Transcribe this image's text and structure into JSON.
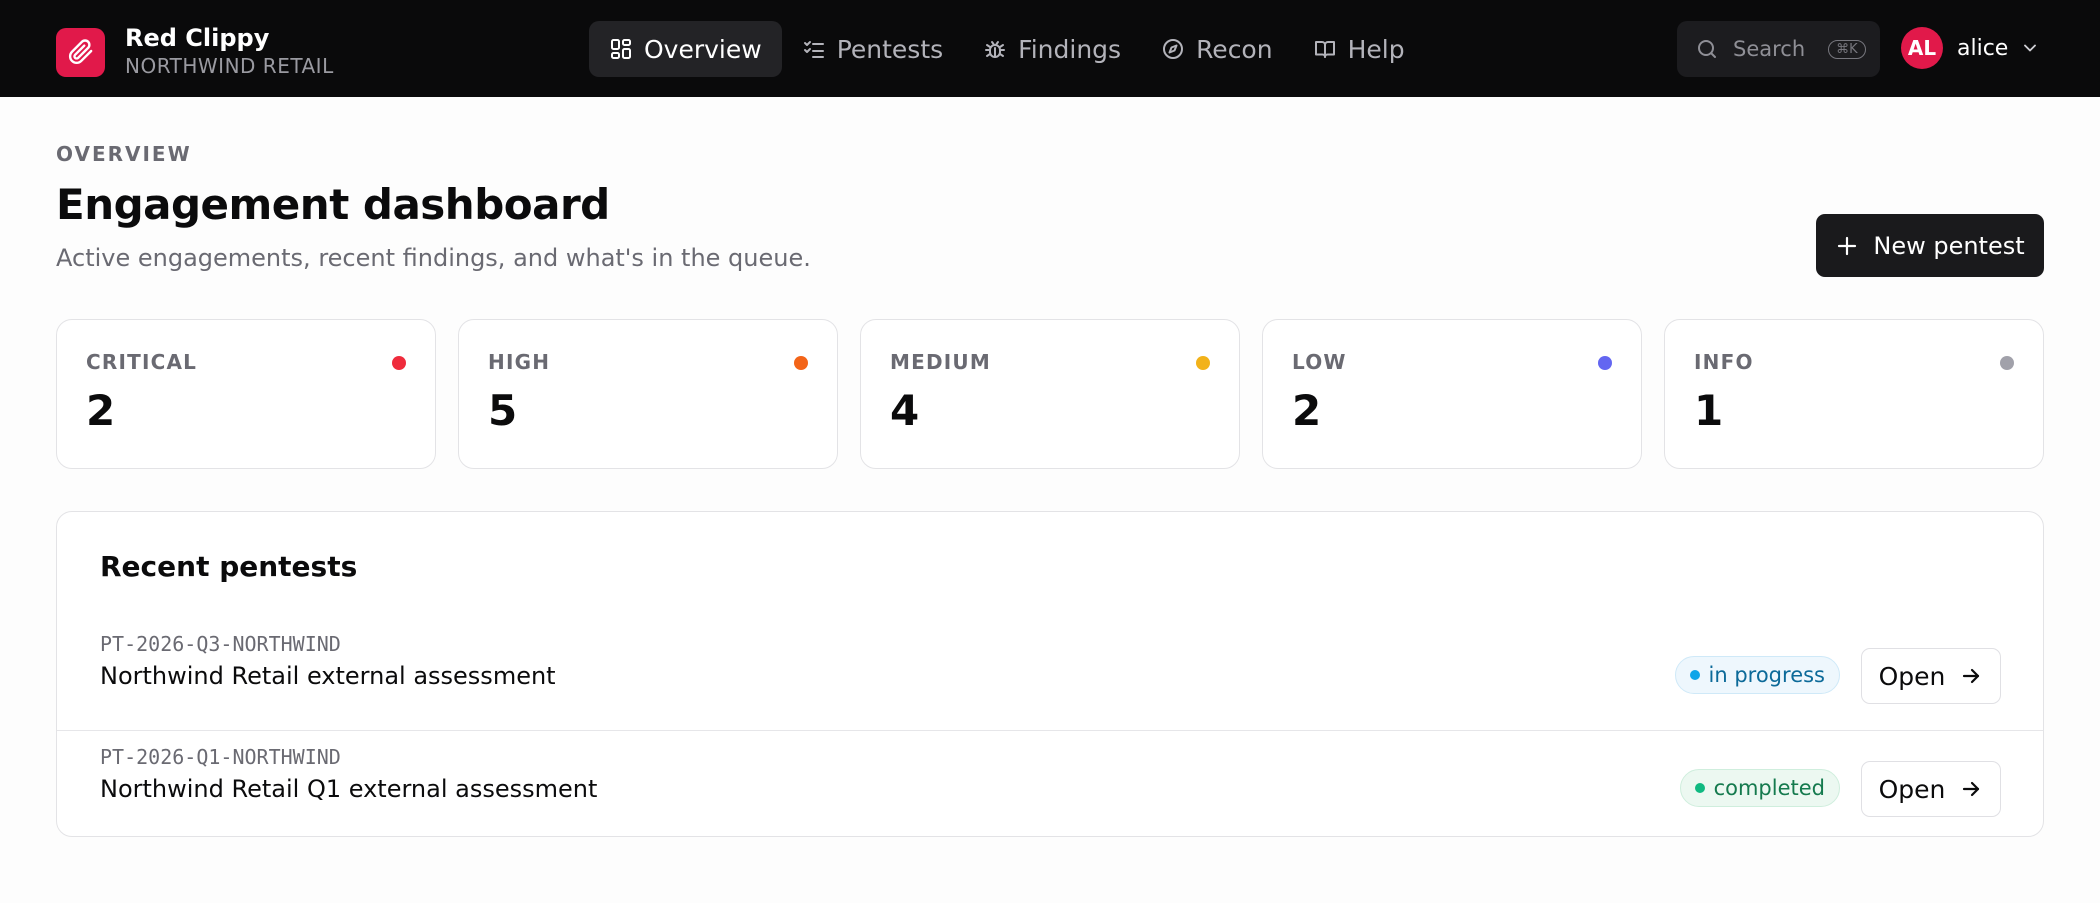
{
  "brand": {
    "name": "Red Clippy",
    "org": "NORTHWIND RETAIL",
    "logo_icon": "paperclip-icon",
    "accent": "#e1194a"
  },
  "nav": {
    "items": [
      {
        "label": "Overview",
        "icon": "dashboard-icon",
        "active": true
      },
      {
        "label": "Pentests",
        "icon": "checklist-icon",
        "active": false
      },
      {
        "label": "Findings",
        "icon": "bug-icon",
        "active": false
      },
      {
        "label": "Recon",
        "icon": "compass-icon",
        "active": false
      },
      {
        "label": "Help",
        "icon": "book-icon",
        "active": false
      }
    ]
  },
  "search": {
    "placeholder": "Search",
    "shortcut": "⌘K"
  },
  "user": {
    "initials": "AL",
    "name": "alice"
  },
  "header": {
    "eyebrow": "OVERVIEW",
    "title": "Engagement dashboard",
    "subtitle": "Active engagements, recent findings, and what's in the queue.",
    "new_button_label": "New pentest"
  },
  "severity": [
    {
      "label": "CRITICAL",
      "count": "2",
      "color": "#ef2b3c"
    },
    {
      "label": "HIGH",
      "count": "5",
      "color": "#f36418"
    },
    {
      "label": "MEDIUM",
      "count": "4",
      "color": "#f2b21a"
    },
    {
      "label": "LOW",
      "count": "2",
      "color": "#6366f1"
    },
    {
      "label": "INFO",
      "count": "1",
      "color": "#a1a1aa"
    }
  ],
  "recent": {
    "title": "Recent pentests",
    "open_label": "Open",
    "rows": [
      {
        "code": "PT-2026-Q3-NORTHWIND",
        "name": "Northwind Retail external assessment",
        "status": "in progress",
        "status_color": "#0ea5e9",
        "status_bg": "#eef7fd",
        "status_border": "#cfe9f8",
        "status_text": "#0c6a99"
      },
      {
        "code": "PT-2026-Q1-NORTHWIND",
        "name": "Northwind Retail Q1 external assessment",
        "status": "completed",
        "status_color": "#10b981",
        "status_bg": "#ecf8f1",
        "status_border": "#cfeedd",
        "status_text": "#157a4e"
      }
    ]
  }
}
